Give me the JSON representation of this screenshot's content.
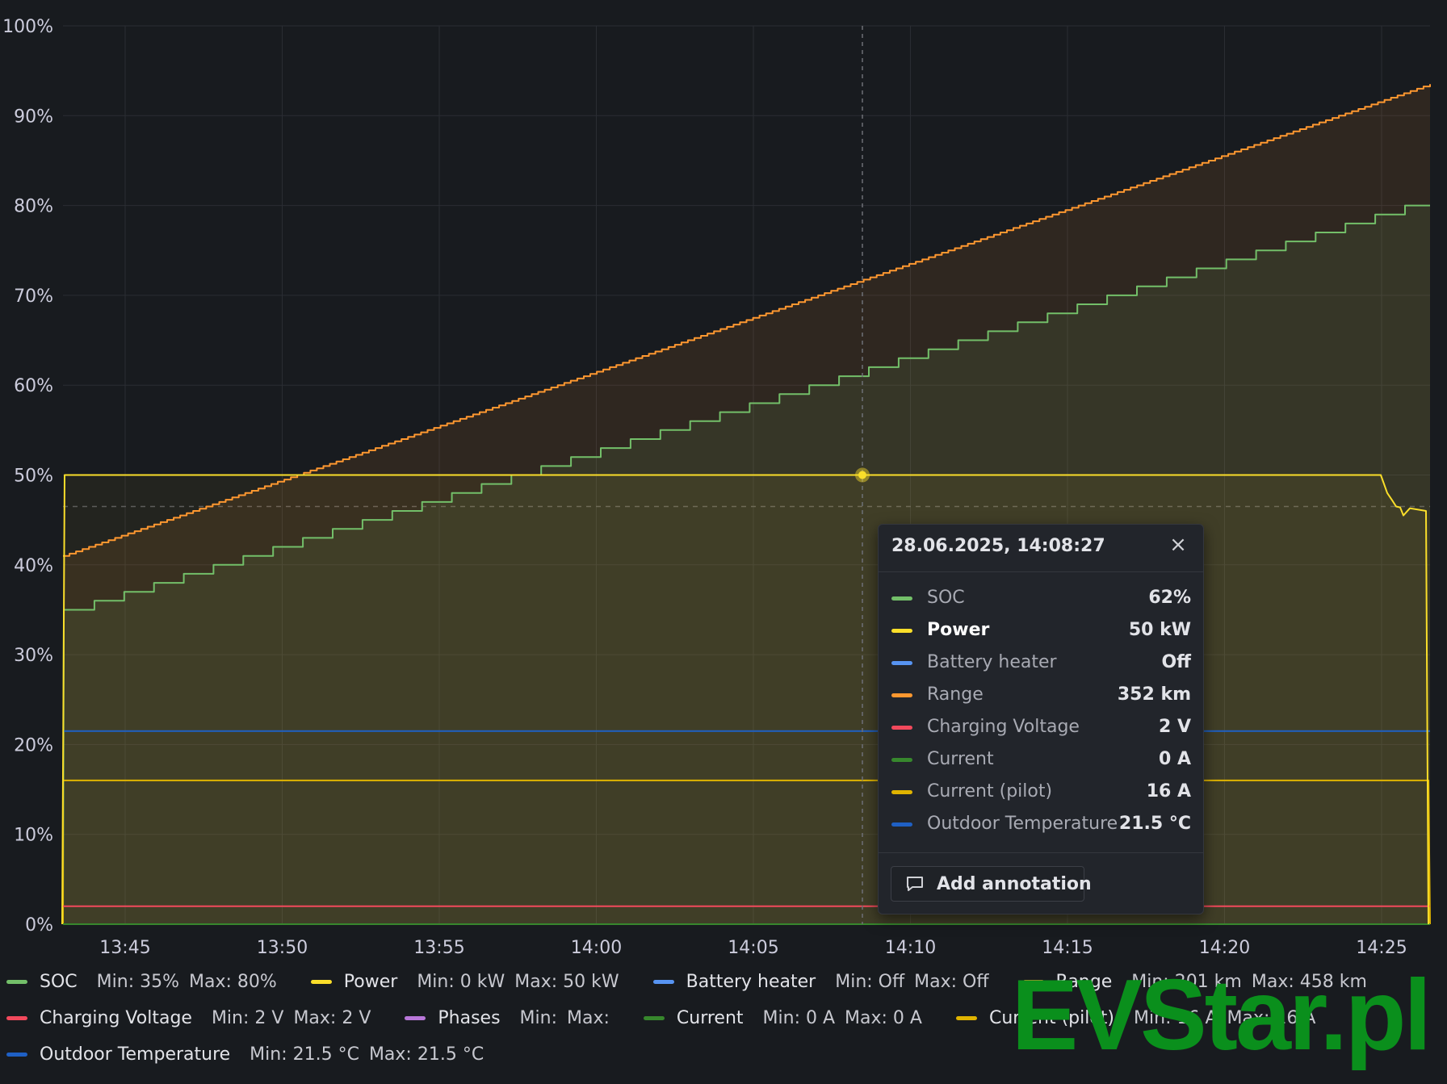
{
  "chart_data": {
    "type": "line",
    "x_ticks": [
      "13:45",
      "13:50",
      "13:55",
      "14:00",
      "14:05",
      "14:10",
      "14:15",
      "14:20",
      "14:25"
    ],
    "y_ticks": [
      "100%",
      "90%",
      "80%",
      "70%",
      "60%",
      "50%",
      "40%",
      "30%",
      "20%",
      "10%",
      "0%"
    ],
    "ylim": [
      0,
      100
    ],
    "xlim_minutes": [
      1183.0,
      1226.4
    ],
    "time_start_label": "13:43",
    "grid": true,
    "legend_placement": "bottom",
    "hover": {
      "time_label": "28.06.2025, 14:08:27",
      "value": 50,
      "series": "Power"
    },
    "series": [
      {
        "name": "SOC",
        "color": "#73bf69",
        "start_x": 13.0,
        "end_x": 1226.0,
        "points": [
          [
            13.0,
            35
          ],
          [
            13.1,
            35
          ],
          [
            15.0,
            35.8
          ],
          [
            20.0,
            37.9
          ],
          [
            25.0,
            40
          ],
          [
            30.0,
            42.1
          ],
          [
            35.0,
            44.2
          ],
          [
            40.0,
            46.3
          ],
          [
            45.0,
            48.4
          ],
          [
            50.0,
            50.5
          ],
          [
            55.0,
            52.6
          ],
          [
            60.0,
            54.7
          ],
          [
            65.0,
            56.8
          ],
          [
            70.0,
            58.9
          ],
          [
            75.0,
            61
          ],
          [
            80.0,
            63.1
          ],
          [
            85.0,
            65.2
          ],
          [
            90.0,
            67.3
          ],
          [
            95.0,
            69.4
          ],
          [
            100.0,
            71.5
          ],
          [
            105.0,
            73.6
          ],
          [
            110.0,
            75.7
          ],
          [
            115.0,
            77.8
          ],
          [
            120.0,
            79.9
          ],
          [
            121.0,
            80
          ]
        ],
        "comment_x": "minutes from 13:43"
      },
      {
        "name": "Power",
        "color": "#fade2a"
      },
      {
        "name": "Battery heater",
        "color": "#5794f2"
      },
      {
        "name": "Range",
        "color": "#ff9830"
      },
      {
        "name": "Charging Voltage",
        "color": "#f2495c"
      },
      {
        "name": "Phases",
        "color": "#b877d9"
      },
      {
        "name": "Current",
        "color": "#37872d"
      },
      {
        "name": "Current (pilot)",
        "color": "#e0b400"
      },
      {
        "name": "Outdoor Temperature",
        "color": "#1f60c4"
      }
    ]
  },
  "tooltip": {
    "time": "28.06.2025, 14:08:27",
    "close_icon": "×",
    "rows": [
      {
        "name": "SOC",
        "value": "62%",
        "color": "#73bf69"
      },
      {
        "name": "Power",
        "value": "50 kW",
        "color": "#fade2a",
        "active": true
      },
      {
        "name": "Battery heater",
        "value": "Off",
        "color": "#5794f2"
      },
      {
        "name": "Range",
        "value": "352 km",
        "color": "#ff9830"
      },
      {
        "name": "Charging Voltage",
        "value": "2 V",
        "color": "#f2495c"
      },
      {
        "name": "Current",
        "value": "0 A",
        "color": "#37872d"
      },
      {
        "name": "Current (pilot)",
        "value": "16 A",
        "color": "#e0b400"
      },
      {
        "name": "Outdoor Temperature",
        "value": "21.5 °C",
        "color": "#1f60c4"
      }
    ],
    "add_annotation": "Add annotation",
    "add_icon": "comment-icon"
  },
  "legend": {
    "rows": [
      [
        {
          "name": "SOC",
          "color": "#73bf69",
          "min": "Min: 35%",
          "max": "Max: 80%"
        },
        {
          "name": "Power",
          "color": "#fade2a",
          "min": "Min: 0 kW",
          "max": "Max: 50 kW"
        },
        {
          "name": "Battery heater",
          "color": "#5794f2",
          "min": "Min: Off",
          "max": "Max: Off"
        },
        {
          "name": "Range",
          "color": "#ff9830",
          "min": "Min: 201 km",
          "max": "Max: 458 km"
        }
      ],
      [
        {
          "name": "Charging Voltage",
          "color": "#f2495c",
          "min": "Min: 2 V",
          "max": "Max: 2 V"
        },
        {
          "name": "Phases",
          "color": "#b877d9",
          "min": "Min:",
          "max": "Max:"
        },
        {
          "name": "Current",
          "color": "#37872d",
          "min": "Min: 0 A",
          "max": "Max: 0 A"
        },
        {
          "name": "Current (pilot)",
          "color": "#e0b400",
          "min": "Min: 16 A",
          "max": "Max: 16 A"
        }
      ],
      [
        {
          "name": "Outdoor Temperature",
          "color": "#1f60c4",
          "min": "Min: 21.5 °C",
          "max": "Max: 21.5 °C"
        }
      ]
    ]
  },
  "watermark": "EVStar.pl"
}
